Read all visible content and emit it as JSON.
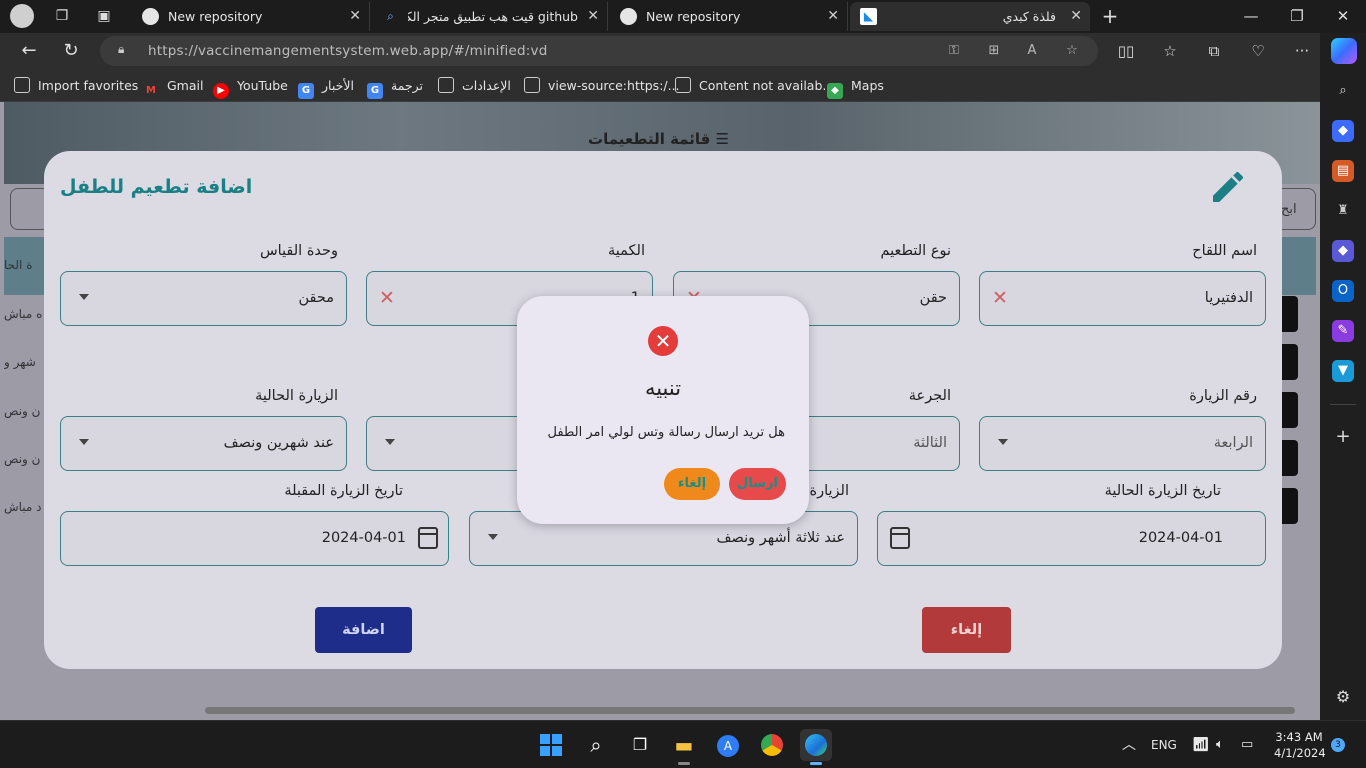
{
  "browser": {
    "tabs": [
      {
        "title": "New repository",
        "icon": "github-icon"
      },
      {
        "title": "github قيت هب تطبيق متجر الكتروني",
        "icon": "search-icon"
      },
      {
        "title": "New repository",
        "icon": "github-icon"
      },
      {
        "title": "فلذة كبدي",
        "icon": "flutter-icon"
      }
    ],
    "url": "https://vaccinemangementsystem.web.app/#/minified:vd",
    "favorites": [
      {
        "label": "Import favorites"
      },
      {
        "label": "Gmail"
      },
      {
        "label": "YouTube"
      },
      {
        "label": "الأخبار"
      },
      {
        "label": "ترجمة"
      },
      {
        "label": "الإعدادات"
      },
      {
        "label": "view-source:https:/..."
      },
      {
        "label": "Content not availab..."
      },
      {
        "label": "Maps"
      }
    ]
  },
  "page": {
    "header_title": "قائمة التطعيمات",
    "search_label": "ابح",
    "left_rows": [
      "ة الحا",
      "ه مباش",
      "شهر و",
      "ن ونص",
      "ن ونص",
      "د مباش"
    ]
  },
  "modal": {
    "title": "اضافة تطعيم للطفل",
    "fields": {
      "vaccine_name": {
        "label": "اسم اللقاح",
        "value": "الدفتيريا"
      },
      "vaccine_type": {
        "label": "نوع التطعيم",
        "value": "حقن"
      },
      "quantity": {
        "label": "الكمية",
        "value": "1"
      },
      "unit": {
        "label": "وحدة القياس",
        "value": "محقن"
      },
      "visit_number": {
        "label": "رقم الزيارة",
        "value": "الرابعة"
      },
      "dose": {
        "label": "الجرعة",
        "value": "الثالثة"
      },
      "current_visit": {
        "label": "الزيارة الحالية",
        "value": "عند شهرين ونصف"
      },
      "current_visit_date": {
        "label": "تاريخ الزيارة الحالية",
        "value": "2024-04-01"
      },
      "next_visit": {
        "label": "الزيارة",
        "value": "عند ثلاثة أشهر ونصف"
      },
      "next_visit_date": {
        "label": "تاريخ الزيارة المقبلة",
        "value": "2024-04-01"
      }
    },
    "add_label": "اضافة",
    "cancel_label": "إلغاء"
  },
  "dialog": {
    "title": "تنبيه",
    "message": "هل تريد ارسال رسالة وتس لولي امر الطفل",
    "send_label": "ارسال",
    "cancel_label": "إلغاء"
  },
  "taskbar": {
    "language": "ENG",
    "time": "3:43 AM",
    "date": "4/1/2024",
    "notifications": "3"
  }
}
